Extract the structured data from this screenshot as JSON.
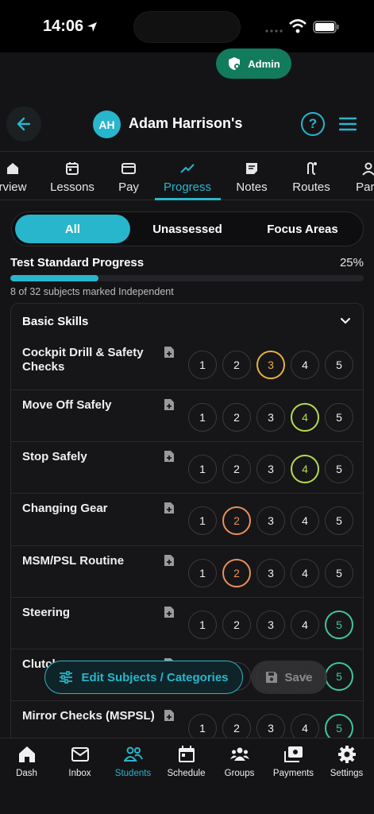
{
  "status_bar": {
    "time": "14:06"
  },
  "admin_badge": {
    "label": "Admin"
  },
  "header": {
    "avatar_initials": "AH",
    "title": "Adam Harrison's",
    "help_label": "?"
  },
  "tabs": [
    {
      "label": "rview",
      "icon": "home-icon"
    },
    {
      "label": "Lessons",
      "icon": "calendar-icon"
    },
    {
      "label": "Pay",
      "icon": "card-icon"
    },
    {
      "label": "Progress",
      "icon": "trend-icon",
      "active": true
    },
    {
      "label": "Notes",
      "icon": "note-icon"
    },
    {
      "label": "Routes",
      "icon": "route-icon"
    },
    {
      "label": "Pare",
      "icon": "person-icon"
    }
  ],
  "filters": {
    "all": "All",
    "unassessed": "Unassessed",
    "focus": "Focus Areas",
    "selected": "All"
  },
  "progress": {
    "title": "Test Standard Progress",
    "percent_label": "25%",
    "fraction": 0.25,
    "subtitle": "8 of 32 subjects marked Independent"
  },
  "card": {
    "title": "Basic Skills",
    "levels": [
      "1",
      "2",
      "3",
      "4",
      "5"
    ],
    "skills": [
      {
        "name": "Cockpit Drill & Safety Checks",
        "selected": 3
      },
      {
        "name": "Move Off Safely",
        "selected": 4
      },
      {
        "name": "Stop Safely",
        "selected": 4
      },
      {
        "name": "Changing Gear",
        "selected": 2
      },
      {
        "name": "MSM/PSL Routine",
        "selected": 2
      },
      {
        "name": "Steering",
        "selected": 5
      },
      {
        "name": "Clutch",
        "selected": 5
      },
      {
        "name": "Mirror Checks (MSPSL)",
        "selected": 5
      }
    ]
  },
  "level_colors": {
    "2": "#e9905a",
    "3": "#e8b23a",
    "4": "#b5db52",
    "5": "#3fc79b"
  },
  "actions": {
    "edit": "Edit Subjects / Categories",
    "save": "Save"
  },
  "bottom_nav": [
    {
      "label": "Dash",
      "icon": "home-icon"
    },
    {
      "label": "Inbox",
      "icon": "mail-icon"
    },
    {
      "label": "Students",
      "icon": "students-icon",
      "active": true
    },
    {
      "label": "Schedule",
      "icon": "calendar-icon"
    },
    {
      "label": "Groups",
      "icon": "groups-icon"
    },
    {
      "label": "Payments",
      "icon": "payments-icon"
    },
    {
      "label": "Settings",
      "icon": "gear-icon"
    }
  ],
  "colors": {
    "accent": "#28b6cc",
    "admin": "#127b5c"
  }
}
